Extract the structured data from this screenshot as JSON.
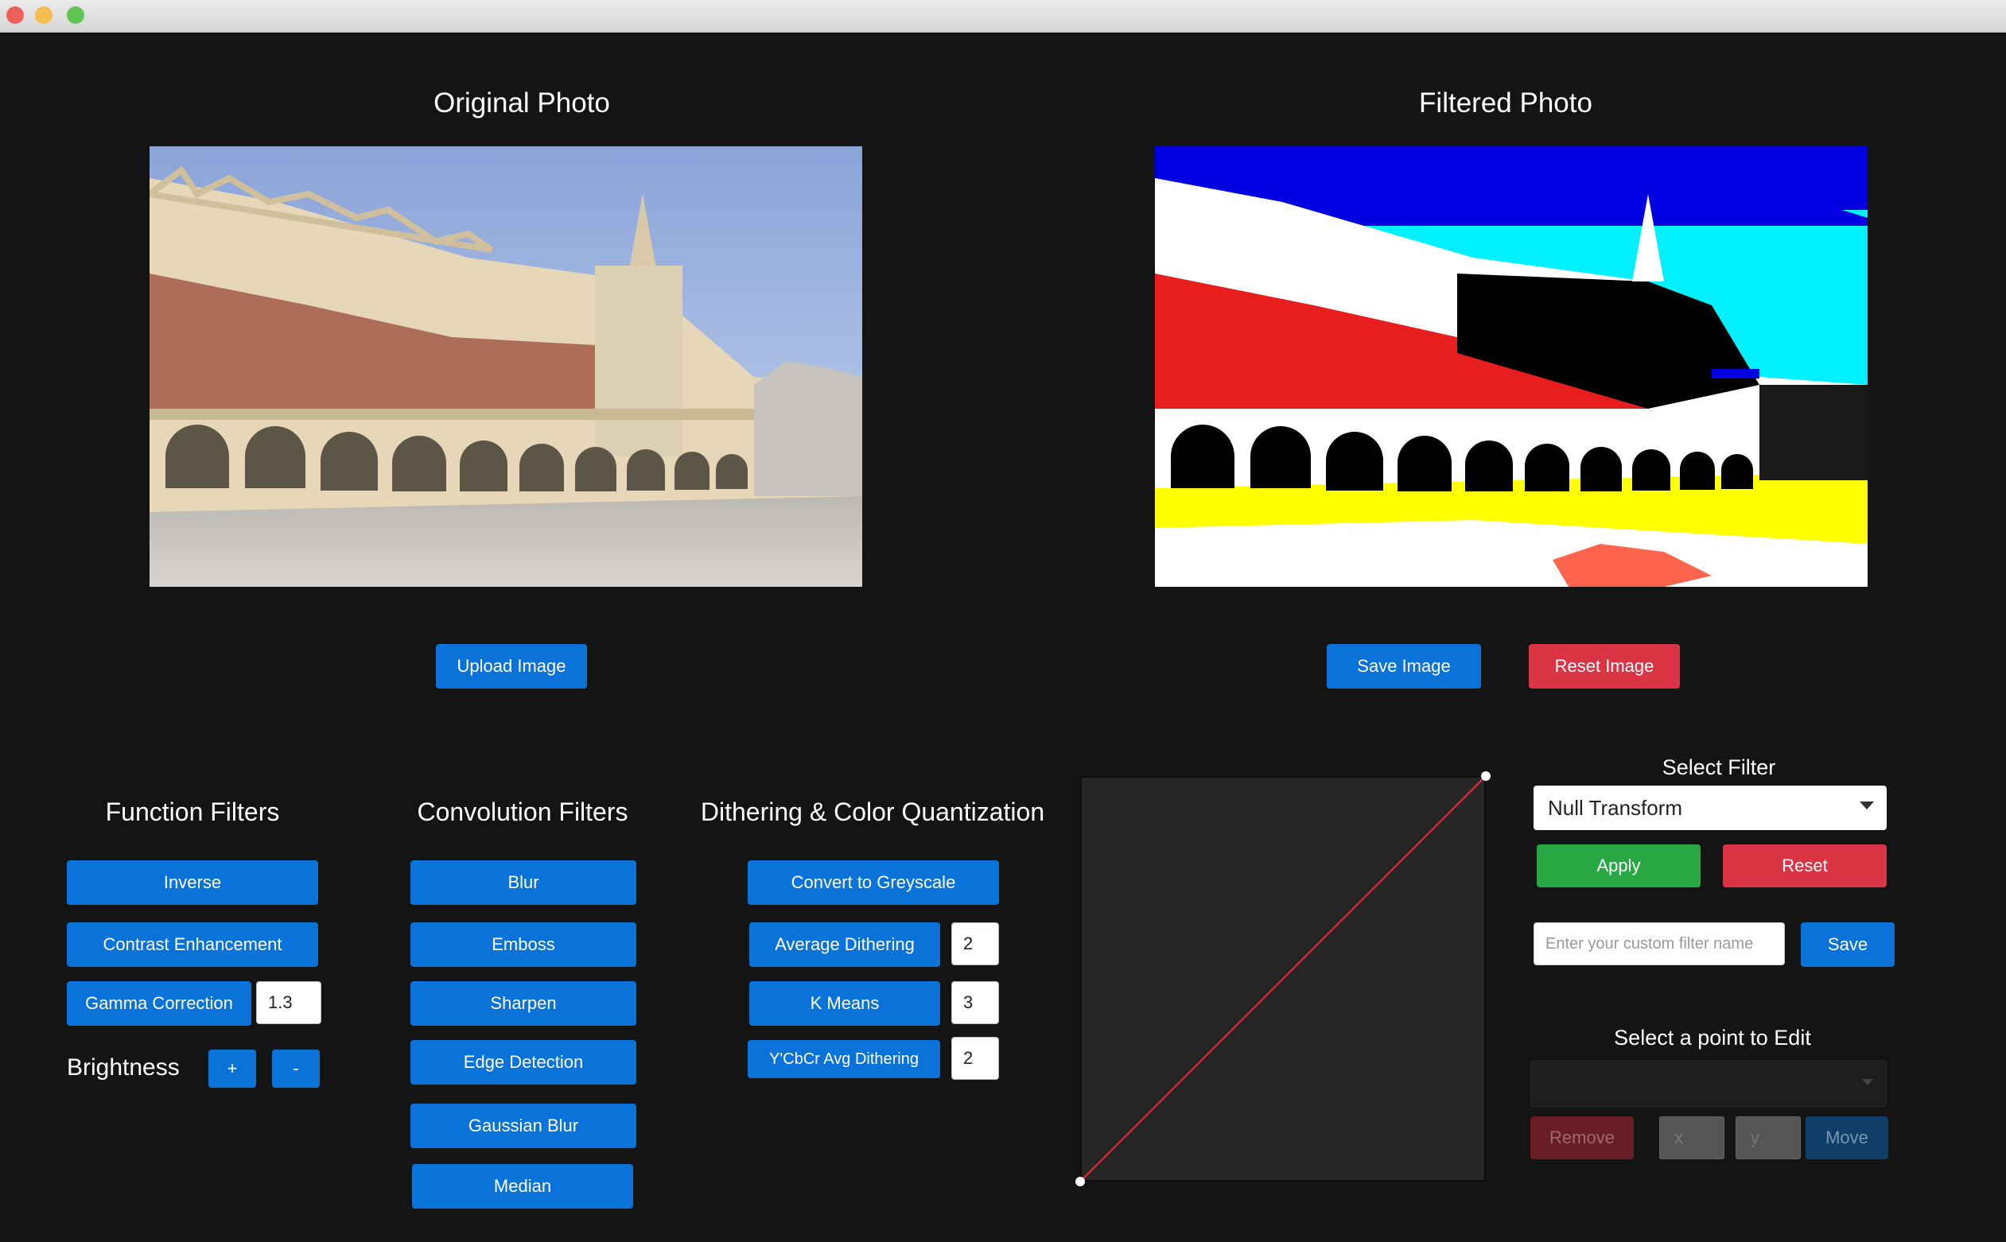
{
  "window": {
    "traffic_lights": [
      "#ed5f57",
      "#f5bf4f",
      "#61c554"
    ]
  },
  "original": {
    "title": "Original Photo",
    "upload_label": "Upload Image"
  },
  "filtered": {
    "title": "Filtered Photo",
    "save_label": "Save Image",
    "reset_label": "Reset Image"
  },
  "function_filters": {
    "title": "Function Filters",
    "inverse": "Inverse",
    "contrast": "Contrast Enhancement",
    "gamma": "Gamma Correction",
    "gamma_value": "1.3",
    "brightness": "Brightness",
    "plus": "+",
    "minus": "-"
  },
  "convolution_filters": {
    "title": "Convolution Filters",
    "items": [
      "Blur",
      "Emboss",
      "Sharpen",
      "Edge Detection",
      "Gaussian Blur",
      "Median"
    ]
  },
  "dithering": {
    "title": "Dithering & Color Quantization",
    "greyscale": "Convert to Greyscale",
    "average": "Average Dithering",
    "average_value": "2",
    "kmeans": "K Means",
    "kmeans_value": "3",
    "ycbcr": "Y'CbCr Avg Dithering",
    "ycbcr_value": "2"
  },
  "filter_panel": {
    "select_title": "Select Filter",
    "selected": "Null Transform",
    "apply": "Apply",
    "reset": "Reset",
    "name_placeholder": "Enter your custom filter name",
    "save": "Save",
    "point_title": "Select a point to Edit",
    "remove": "Remove",
    "x_placeholder": "x",
    "y_placeholder": "y",
    "move": "Move"
  },
  "colors": {
    "primary": "#0a73d9",
    "danger": "#db3445",
    "success": "#27a844",
    "curve": "#e0324a"
  }
}
